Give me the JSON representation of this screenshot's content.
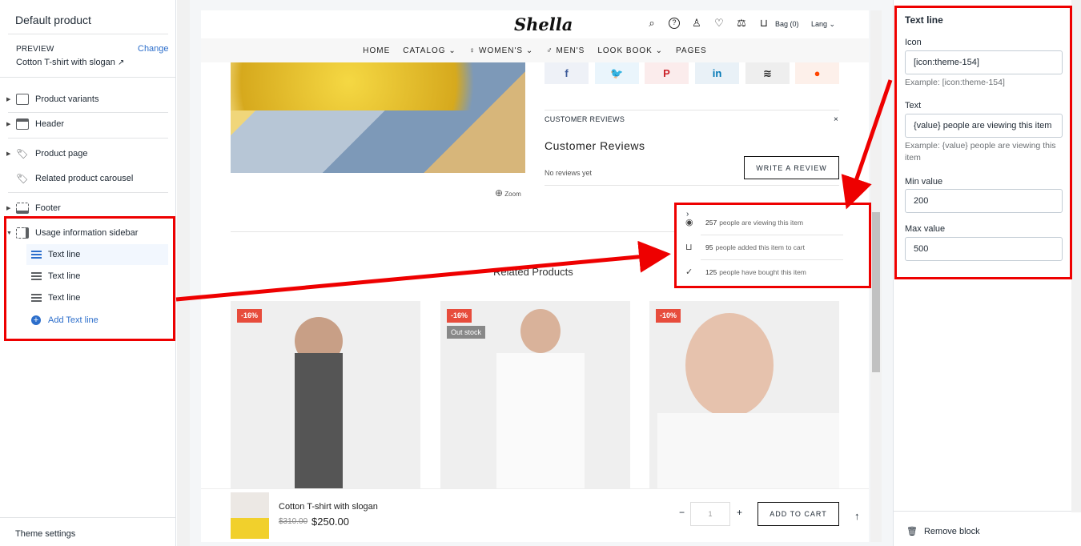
{
  "left": {
    "title": "Default product",
    "preview_label": "PREVIEW",
    "change_label": "Change",
    "preview_value": "Cotton T-shirt with slogan",
    "sections": [
      {
        "label": "Product variants",
        "icon": "image-icon"
      },
      {
        "label": "Header",
        "icon": "header-icon"
      },
      {
        "label": "Product page",
        "icon": "tag-icon"
      },
      {
        "label": "Related product carousel",
        "icon": "tag-icon"
      },
      {
        "label": "Footer",
        "icon": "footer-icon"
      },
      {
        "label": "Usage information sidebar",
        "icon": "sidebar-icon"
      }
    ],
    "blocks": [
      "Text line",
      "Text line",
      "Text line"
    ],
    "add_block": "Add Text line",
    "theme_settings": "Theme settings"
  },
  "store": {
    "logo": "Shella",
    "bag": "Bag (0)",
    "lang": "Lang",
    "nav": [
      "HOME",
      "CATALOG",
      "WOMEN'S",
      "MEN'S",
      "LOOK BOOK",
      "PAGES"
    ],
    "reviews_header": "CUSTOMER REVIEWS",
    "reviews_close": "×",
    "reviews_title": "Customer Reviews",
    "no_reviews": "No reviews yet",
    "write_review": "WRITE A REVIEW",
    "zoom": "Zoom",
    "related_title": "Related Products",
    "cards": [
      {
        "badge": "-16%",
        "badge2": ""
      },
      {
        "badge": "-16%",
        "badge2": "Out stock"
      },
      {
        "badge": "-10%",
        "badge2": ""
      }
    ],
    "sticky": {
      "name": "Cotton T-shirt with slogan",
      "old_price": "$310.00",
      "price": "$250.00",
      "minus": "−",
      "qty": "1",
      "plus": "+",
      "add_to_cart": "ADD TO CART"
    },
    "usage_popup": [
      {
        "count": "257",
        "text": "people are viewing this item",
        "icon": "eye-icon"
      },
      {
        "count": "95",
        "text": "people added this item to cart",
        "icon": "bag-icon"
      },
      {
        "count": "125",
        "text": "people have bought this item",
        "icon": "check-icon"
      }
    ]
  },
  "right": {
    "title": "Text line",
    "icon_label": "Icon",
    "icon_value": "[icon:theme-154]",
    "icon_help": "Example: [icon:theme-154]",
    "text_label": "Text",
    "text_value": "{value} people are viewing this item",
    "text_help": "Example: {value} people are viewing this item",
    "min_label": "Min value",
    "min_value": "200",
    "max_label": "Max value",
    "max_value": "500",
    "remove": "Remove block"
  },
  "colors": {
    "accent": "#2c6ecb",
    "annotation": "#e00000",
    "sale_badge": "#e74c3c"
  }
}
